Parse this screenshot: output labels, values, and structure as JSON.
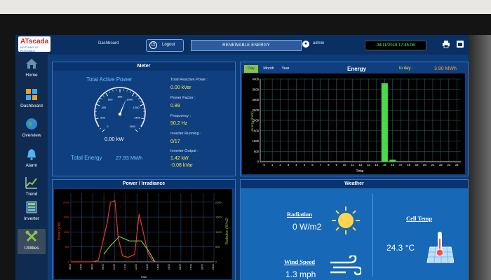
{
  "header": {
    "logo_main": "ATscada",
    "logo_sub": "NOTHING IS POSSIBLE",
    "dashboard_link": "Dashboard",
    "logout_label": "Logout",
    "title": "RENEWABLE ENERGY",
    "user": "admin",
    "datetime": "08/11/2019 17:45:06"
  },
  "sidebar": {
    "items": [
      {
        "label": "Home"
      },
      {
        "label": "Dashboard"
      },
      {
        "label": "Overview"
      },
      {
        "label": "Alarm"
      },
      {
        "label": "Trend"
      },
      {
        "label": "Inverter"
      },
      {
        "label": "Utilities"
      }
    ]
  },
  "meter": {
    "title": "Meter",
    "active_power_label": "Total Active Power",
    "active_power_value": "0.00 kW",
    "gauge_ticks": [
      "0",
      "200",
      "400",
      "600",
      "800",
      "1000",
      "1200",
      "1400",
      "1600"
    ],
    "total_energy_label": "Total Energy",
    "total_energy_value": "27.93 MWh",
    "reactive_label": "Total Reactive Powe :",
    "reactive_value": "0.00 kVar",
    "pf_label": "Power Factor :",
    "pf_value": "0.89",
    "freq_label": "Frequency :",
    "freq_value": "50.2 Hz",
    "inv_running_label": "Inverter Running :",
    "inv_running_value": "0/17",
    "inv_output_label": "Inverter Output :",
    "inv_output_value1": "1.42 kW",
    "inv_output_value2": "-0.08 kVar"
  },
  "energy": {
    "title": "Energy",
    "tabs": [
      "Day",
      "Month",
      "Year"
    ],
    "today_label": "to day :",
    "today_value": "3.90 MWh",
    "chart_data": {
      "type": "bar",
      "categories": [
        "0",
        "1",
        "2",
        "3",
        "4",
        "5",
        "6",
        "7",
        "8",
        "9",
        "10",
        "11",
        "12",
        "13",
        "14",
        "15",
        "16",
        "17",
        "18",
        "19",
        "20",
        "21",
        "22",
        "23",
        "24"
      ],
      "values": [
        0,
        0,
        0,
        0,
        0,
        0,
        0,
        0,
        0,
        0,
        0,
        0,
        0,
        0,
        0,
        3800,
        100,
        0,
        0,
        0,
        0,
        0,
        0,
        0,
        0
      ],
      "ylim": [
        0,
        4000
      ],
      "yticks": [
        "0",
        "500",
        "1000",
        "1500",
        "2000",
        "2500",
        "3000",
        "3500",
        "4000"
      ],
      "xlabel": "Time",
      "ylabel": "Energy (kWh)",
      "color": "#49d84a"
    }
  },
  "power": {
    "title": "Power / Irradiance",
    "chart_data": {
      "type": "line",
      "left_ylabel": "Power (kW)",
      "right_ylabel": "Radiation (W/m2)",
      "xlabel": "Time",
      "left_yticks": [
        "0",
        "500",
        "1000",
        "1500",
        "2000"
      ],
      "right_yticks": [
        "0",
        "500",
        "1000",
        "1500",
        "2000"
      ],
      "xticks": [
        "06:00",
        "07:00",
        "08:00",
        "09:00",
        "10:00",
        "11:00",
        "12:00",
        "13:00",
        "14:00",
        "15:00",
        "16:00",
        "17:00",
        "18:00",
        "19:00"
      ],
      "series": [
        {
          "color": "#e53935",
          "points": [
            [
              0,
              0
            ],
            [
              0.4,
              0
            ],
            [
              0.8,
              0
            ],
            [
              1.2,
              0
            ],
            [
              2.0,
              0
            ],
            [
              2.5,
              50
            ],
            [
              3.3,
              1300
            ],
            [
              3.6,
              2000
            ],
            [
              4.0,
              2050
            ],
            [
              4.3,
              800
            ],
            [
              4.7,
              200
            ],
            [
              5.2,
              150
            ],
            [
              5.8,
              250
            ],
            [
              6.2,
              1600
            ],
            [
              6.7,
              800
            ],
            [
              7.0,
              300
            ],
            [
              7.4,
              50
            ],
            [
              7.8,
              0
            ]
          ]
        },
        {
          "color": "#8bc34a",
          "points": [
            [
              3.0,
              250
            ],
            [
              3.5,
              500
            ],
            [
              4.4,
              850
            ],
            [
              5.3,
              700
            ],
            [
              5.8,
              700
            ],
            [
              6.4,
              700
            ],
            [
              7.0,
              400
            ],
            [
              7.4,
              150
            ],
            [
              7.6,
              0
            ]
          ]
        }
      ]
    }
  },
  "weather": {
    "title": "Weather",
    "radiation_label": "Radiation",
    "radiation_value": "0 W/m2",
    "wind_label": "Wind Speed",
    "wind_value": "1.3 mph",
    "cell_temp_label": "Cell Temp",
    "cell_temp_value": "24.3 °C"
  }
}
